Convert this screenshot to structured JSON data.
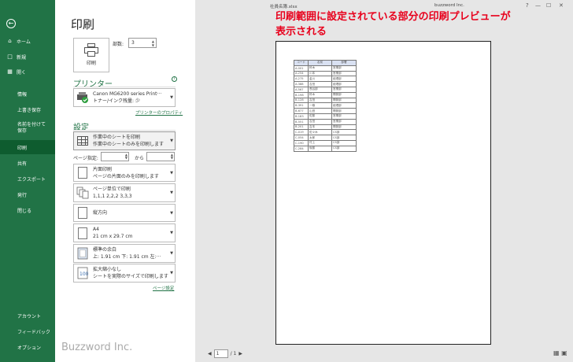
{
  "sidebar": {
    "back_icon": "arrow-left-icon",
    "items": [
      {
        "label": "ホーム",
        "icon": "home-icon"
      },
      {
        "label": "新規",
        "icon": "new-doc-icon"
      },
      {
        "label": "開く",
        "icon": "folder-open-icon"
      },
      {
        "label": "情報"
      },
      {
        "label": "上書き保存"
      },
      {
        "label": "名前を付けて保存"
      },
      {
        "label": "印刷",
        "active": true
      },
      {
        "label": "共有"
      },
      {
        "label": "エクスポート"
      },
      {
        "label": "発行"
      },
      {
        "label": "閉じる"
      }
    ],
    "bottom_items": [
      {
        "label": "アカウント"
      },
      {
        "label": "フィードバック"
      },
      {
        "label": "オプション"
      }
    ]
  },
  "print": {
    "title": "印刷",
    "print_button_label": "印刷",
    "copies_label": "部数:",
    "copies_value": "3"
  },
  "printer": {
    "section_title": "プリンター",
    "name": "Canon MG6200 series Print···",
    "status": "トナー/インク残量: 少",
    "properties_link": "プリンターのプロパティ"
  },
  "settings": {
    "section_title": "設定",
    "what": {
      "line1": "作業中のシートを印刷",
      "line2": "作業中のシートのみを印刷します"
    },
    "page_range_label": "ページ指定:",
    "page_range_to": "から",
    "sides": {
      "line1": "片面印刷",
      "line2": "ページの片面のみを印刷します"
    },
    "collate": {
      "line1": "ページ単位で印刷",
      "line2": "1,1,1   2,2,2   3,3,3"
    },
    "orientation": {
      "line1": "縦方向"
    },
    "paper": {
      "line1": "A4",
      "line2": "21 cm x 29.7 cm"
    },
    "margins": {
      "line1": "標準の余白",
      "line2": "上: 1.91 cm 下: 1.91 cm 左:···"
    },
    "scaling": {
      "line1": "拡大縮小なし",
      "line2": "シートを実際のサイズで印刷します"
    },
    "page_setup_link": "ページ設定"
  },
  "brand": "Buzzword Inc.",
  "titlebar": {
    "doc_title": "社員名簿.xlsx",
    "user_name": "buzzword Inc.",
    "controls": [
      "?",
      "—",
      "☐",
      "✕"
    ]
  },
  "annotation": {
    "line1": "印刷範囲に設定されている部分の印刷プレビューが",
    "line2": "表示される"
  },
  "preview": {
    "headers": [
      "コード",
      "名前",
      "部署"
    ],
    "rows": [
      [
        "A-001",
        "鈴木",
        "営業部"
      ],
      [
        "A-254",
        "川本",
        "営業部"
      ],
      [
        "A-275",
        "金川",
        "経理部"
      ],
      [
        "A-388",
        "吉田",
        "経理部"
      ],
      [
        "A-567",
        "長谷部",
        "営業部"
      ],
      [
        "B-198",
        "鈴木",
        "開発部"
      ],
      [
        "B-128",
        "吉田",
        "開発部"
      ],
      [
        "B-391",
        "一條",
        "経理部"
      ],
      [
        "B-677",
        "山田",
        "開発部"
      ],
      [
        "B-183",
        "佐藤",
        "営業部"
      ],
      [
        "B-551",
        "吉田",
        "営業部"
      ],
      [
        "B-201",
        "吉本",
        "開発部"
      ],
      [
        "C-019",
        "佐々木",
        "CS部"
      ],
      [
        "C-054",
        "太郎",
        "CS部"
      ],
      [
        "C-190",
        "村上",
        "CS部"
      ],
      [
        "C-284",
        "後藤",
        "CS部"
      ]
    ]
  },
  "pager": {
    "current": "1",
    "total": "/ 1",
    "prev": "◀",
    "next": "▶"
  }
}
